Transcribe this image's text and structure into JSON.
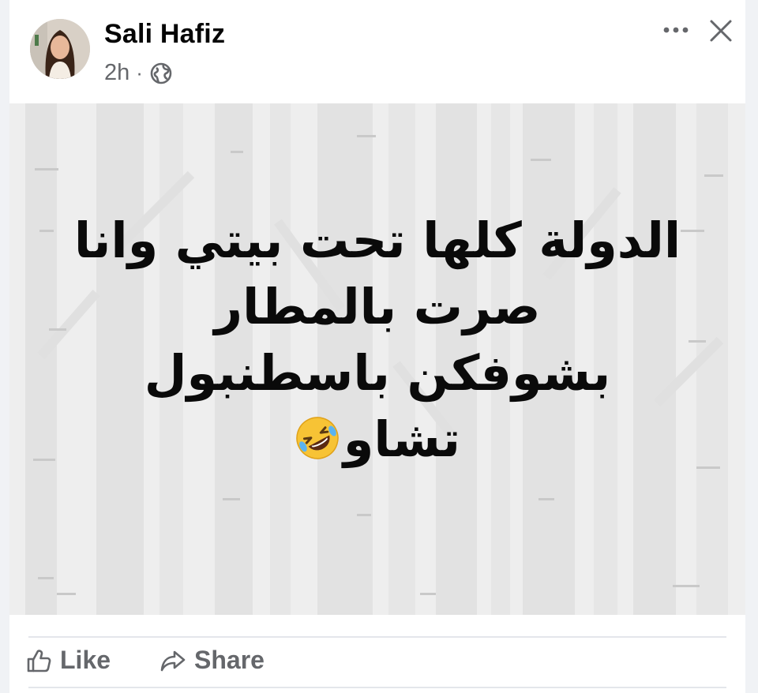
{
  "post": {
    "author_name": "Sali Hafiz",
    "timestamp": "2h",
    "separator": "·",
    "audience_icon": "globe-icon",
    "text_lines": [
      "الدولة كلها تحت بيتي وانا",
      "صرت بالمطار",
      "بشوفكن باسطنبول",
      "تشاو"
    ],
    "emoji": "rolling-on-floor-laughing-emoji"
  },
  "header_actions": {
    "more_icon": "more-options-icon",
    "close_icon": "close-icon"
  },
  "actions": {
    "like_label": "Like",
    "like_icon": "thumbs-up-icon",
    "share_label": "Share",
    "share_icon": "share-arrow-icon"
  },
  "colors": {
    "name_text": "#050505",
    "secondary_text": "#65676b",
    "divider": "#e4e6eb",
    "image_background": "#eeeeee"
  }
}
